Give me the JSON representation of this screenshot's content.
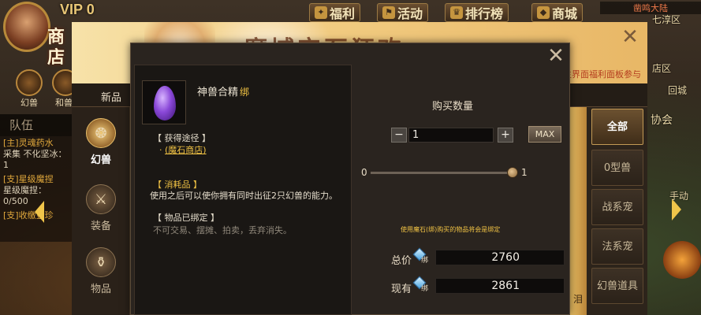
{
  "hud": {
    "vip": "VIP 0",
    "menu": [
      {
        "icon": "gift-icon",
        "label": "福利"
      },
      {
        "icon": "flag-icon",
        "label": "活动"
      },
      {
        "icon": "trophy-icon",
        "label": "排行榜"
      },
      {
        "icon": "shop-icon",
        "label": "商城"
      }
    ],
    "notice": "凿鸣大陆",
    "huanshou_label": "幻兽",
    "heshou_label": "和兽",
    "team_tab": "队伍",
    "tasks": [
      {
        "title": "[主]灵魂药水",
        "detail": "采集 不化坚冰：1"
      },
      {
        "title": "[支]星级魔捏",
        "detail": "星级魔捏：0/500"
      },
      {
        "title": "[支]收缴金珍",
        "detail": ""
      }
    ],
    "right_labels": [
      "七淳区",
      "店区",
      "回城",
      "协会",
      "手动"
    ]
  },
  "shop": {
    "title_badge": "商店",
    "banner_title": "魔域宝石狂欢",
    "banner_hint": "生界面福利面板参与",
    "top_tab": "新品",
    "categories": [
      {
        "icon": "beast-icon",
        "label": "幻兽",
        "active": true
      },
      {
        "icon": "armor-icon",
        "label": "装备",
        "active": false
      },
      {
        "icon": "potion-icon",
        "label": "物品",
        "active": false
      }
    ],
    "right_categories": [
      "全部",
      "0型兽",
      "战系宠",
      "法系宠",
      "幻兽道具"
    ],
    "right_active": "全部",
    "strip_label": "泪"
  },
  "dialog": {
    "item": {
      "name": "神兽合精",
      "bind_tag": "绑",
      "icon": "purple-gem-icon"
    },
    "source_head": "【 获得途径 】",
    "source_link": "(魔石商店)",
    "consume_head": "【 消耗品 】",
    "consume_desc": "使用之后可以使你拥有同时出征2只幻兽的能力。",
    "bound_head": "【 物品已绑定 】",
    "bound_desc": "不可交易、摆摊、拍卖，丢弃消失。",
    "qty_title": "购买数量",
    "qty_value": "1",
    "minus": "−",
    "plus": "+",
    "max_label": "MAX",
    "slider_min": "0",
    "slider_max": "1",
    "slider_level": 1,
    "bind_note": "使用魔石(绑)购买的物品将会是绑定",
    "price_label": "总价",
    "price_value": "2760",
    "own_label": "现有",
    "own_value": "2861",
    "currency_tag": "绑",
    "currency_icon": "blue-diamond-icon",
    "close": "✕"
  },
  "colors": {
    "accent_gold": "#f0c244",
    "panel_bg": "#2a241f",
    "item_purple": "#8a48d8"
  }
}
